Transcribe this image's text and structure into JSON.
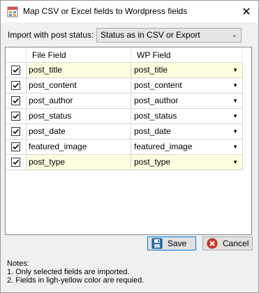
{
  "window": {
    "title": "Map CSV or Excel fields to Wordpress fields",
    "close_glyph": "✕",
    "icon": "table-icon"
  },
  "status": {
    "label": "Import with post status:",
    "selected": "Status as in CSV or Export"
  },
  "grid": {
    "headers": {
      "file": "File Field",
      "wp": "WP Field"
    },
    "rows": [
      {
        "checked": true,
        "file": "post_title",
        "wp": "post_title",
        "required": true
      },
      {
        "checked": true,
        "file": "post_content",
        "wp": "post_content",
        "required": false
      },
      {
        "checked": true,
        "file": "post_author",
        "wp": "post_author",
        "required": false
      },
      {
        "checked": true,
        "file": "post_status",
        "wp": "post_status",
        "required": false
      },
      {
        "checked": true,
        "file": "post_date",
        "wp": "post_date",
        "required": false
      },
      {
        "checked": true,
        "file": "featured_image",
        "wp": "featured_image",
        "required": false
      },
      {
        "checked": true,
        "file": "post_type",
        "wp": "post_type",
        "required": true
      }
    ]
  },
  "buttons": {
    "save": "Save",
    "cancel": "Cancel"
  },
  "notes": {
    "title": "Notes:",
    "line1": "1. Only selected fields are imported.",
    "line2": "2. Fields in ligh-yellow color are requied."
  },
  "colors": {
    "required_bg": "#fdfde0",
    "accent": "#0078d7"
  }
}
